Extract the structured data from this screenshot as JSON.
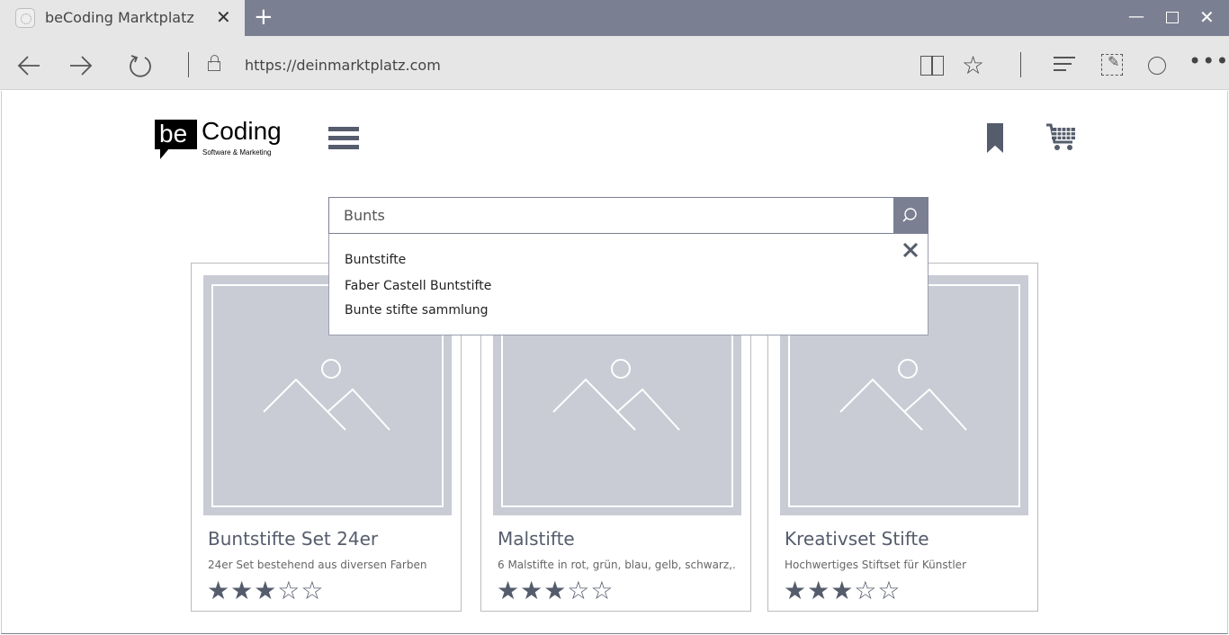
{
  "browser": {
    "tab_title": "beCoding Marktplatz",
    "tab_close": "✕",
    "new_tab": "+",
    "url": "https://deinmarktplatz.com",
    "window_min": "—",
    "window_close": "✕"
  },
  "header": {
    "logo_be": "be",
    "logo_coding": "Coding",
    "logo_sub": "Software & Marketing"
  },
  "search": {
    "value": "Bunts",
    "suggestions": [
      "Buntstifte",
      "Faber Castell Buntstifte",
      "Bunte stifte sammlung"
    ]
  },
  "products": [
    {
      "title": "Buntstifte Set 24er",
      "desc": "24er Set bestehend aus diversen Farben",
      "rating": 3,
      "max": 5
    },
    {
      "title": "Malstifte",
      "desc": "6 Malstifte in rot, grün, blau, gelb, schwarz,..",
      "rating": 3,
      "max": 5
    },
    {
      "title": "Kreativset Stifte",
      "desc": "Hochwertiges Stiftset für Künstler",
      "rating": 3,
      "max": 5
    }
  ],
  "colors": {
    "accent": "#555c6c",
    "chrome": "#7b7f92",
    "placeholder": "#c9ccd5"
  }
}
